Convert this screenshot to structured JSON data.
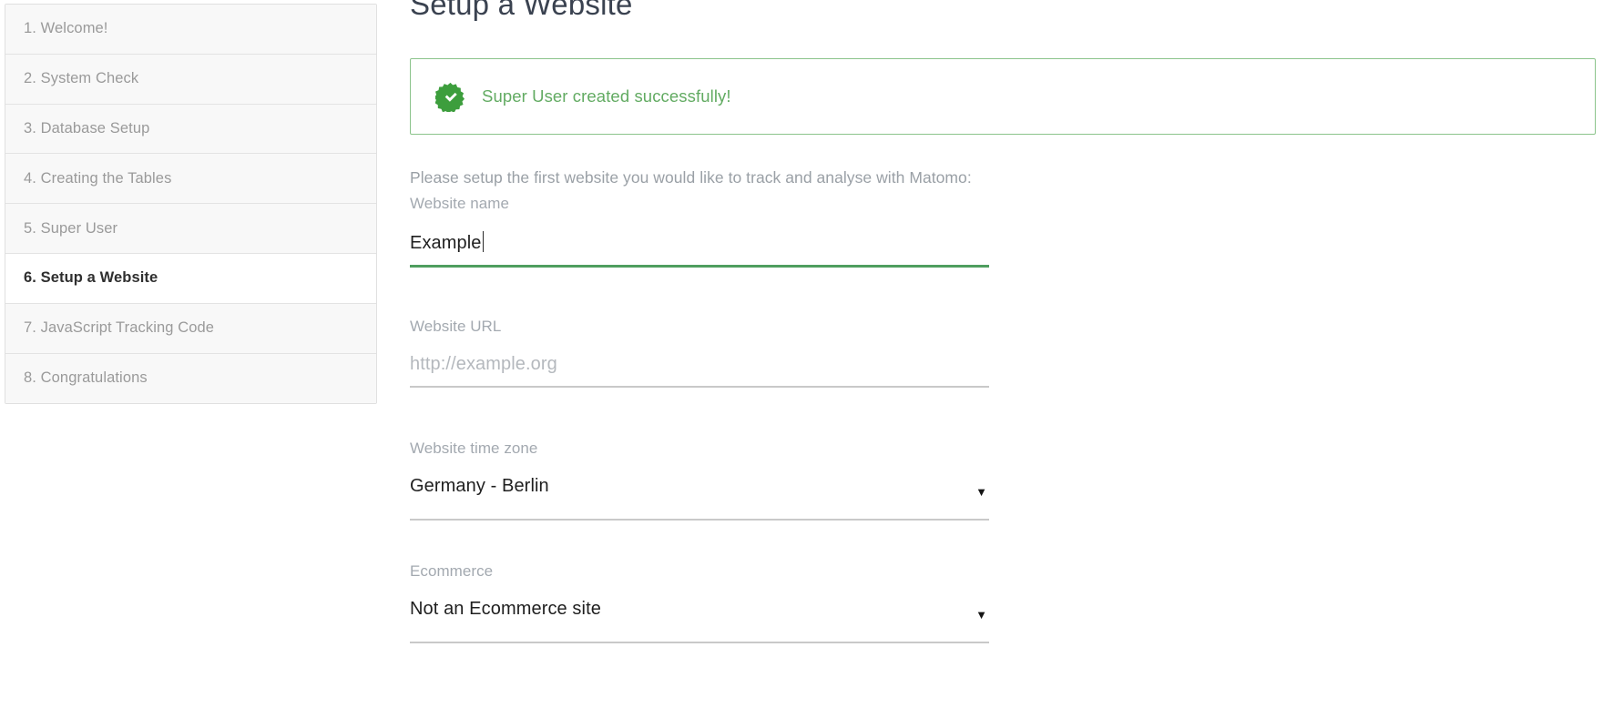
{
  "app": {
    "name": "Matomo",
    "accent_green": "#4f9e5f",
    "success_green": "#62ab62",
    "success_border": "#8bc48b"
  },
  "sidebar": {
    "items": [
      {
        "label": "1. Welcome!",
        "active": false
      },
      {
        "label": "2. System Check",
        "active": false
      },
      {
        "label": "3. Database Setup",
        "active": false
      },
      {
        "label": "4. Creating the Tables",
        "active": false
      },
      {
        "label": "5. Super User",
        "active": false
      },
      {
        "label": "6. Setup a Website",
        "active": true
      },
      {
        "label": "7. JavaScript Tracking Code",
        "active": false
      },
      {
        "label": "8. Congratulations",
        "active": false
      }
    ]
  },
  "main": {
    "title": "Setup a Website",
    "notification": {
      "icon": "check-badge-icon",
      "message": "Super User created successfully!"
    },
    "intro": "Please setup the first website you would like to track and analyse with Matomo:",
    "fields": {
      "website_name": {
        "label": "Website name",
        "value": "Example",
        "placeholder": "",
        "focused": true,
        "has_caret": true
      },
      "website_url": {
        "label": "Website URL",
        "value": "",
        "placeholder": "http://example.org",
        "focused": false,
        "has_caret": false
      },
      "timezone": {
        "label": "Website time zone",
        "value": "Germany - Berlin",
        "caret_glyph": "▼"
      },
      "ecommerce": {
        "label": "Ecommerce",
        "value": "Not an Ecommerce site",
        "caret_glyph": "▼"
      }
    }
  }
}
